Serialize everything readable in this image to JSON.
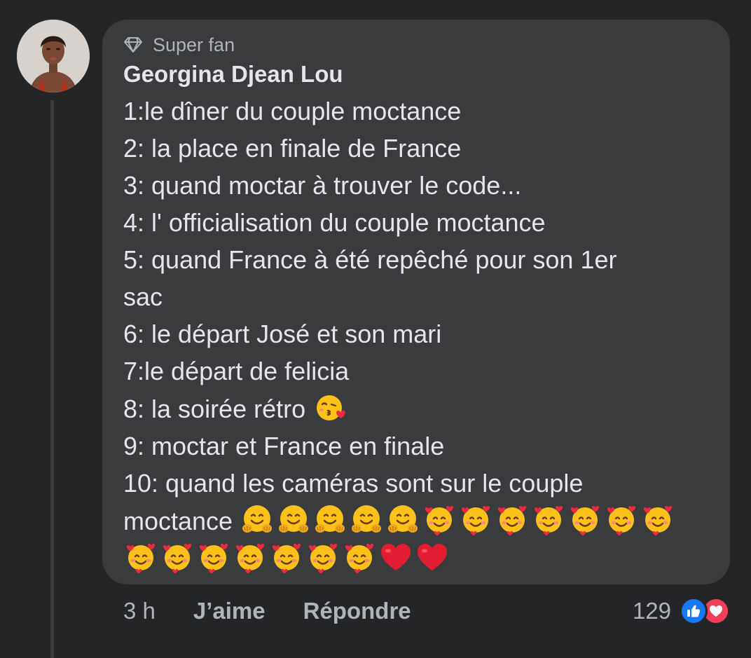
{
  "comment": {
    "badge": "Super fan",
    "author": "Georgina Djean Lou",
    "lines": [
      "1:le dîner du couple moctance",
      "2: la place en finale de France",
      "3: quand moctar à trouver le code...",
      "4: l' officialisation du couple moctance",
      "5: quand France à été repêché pour son 1er",
      "sac",
      "6: le départ José et son mari",
      "7:le départ de felicia",
      "8: la soirée rétro",
      "9: moctar et France en finale",
      "10: quand les caméras sont sur le couple",
      "moctance",
      ""
    ],
    "emoji_line8": [
      "face-blowing-kiss-icon"
    ],
    "emoji_line12": [
      "hugging-face-icon",
      "hugging-face-icon",
      "hugging-face-icon",
      "hugging-face-icon",
      "hugging-face-icon",
      "smiling-face-with-hearts-icon",
      "smiling-face-with-hearts-icon",
      "smiling-face-with-hearts-icon",
      "smiling-face-with-hearts-icon",
      "smiling-face-with-hearts-icon",
      "smiling-face-with-hearts-icon",
      "smiling-face-with-hearts-icon"
    ],
    "emoji_line13": [
      "smiling-face-with-hearts-icon",
      "smiling-face-with-hearts-icon",
      "smiling-face-with-hearts-icon",
      "smiling-face-with-hearts-icon",
      "smiling-face-with-hearts-icon",
      "smiling-face-with-hearts-icon",
      "smiling-face-with-hearts-icon",
      "red-heart-icon",
      "red-heart-icon"
    ]
  },
  "actions": {
    "time": "3 h",
    "like_label": "J’aime",
    "reply_label": "Répondre"
  },
  "reactions": {
    "count": "129",
    "icons": [
      "like-reaction-icon",
      "love-reaction-icon"
    ]
  },
  "colors": {
    "background": "#242526",
    "bubble": "#3a3b3c",
    "text": "#e4e6eb",
    "secondary_text": "#b0b3b8",
    "like_blue": "#1877f2",
    "love_red": "#f33e58"
  }
}
